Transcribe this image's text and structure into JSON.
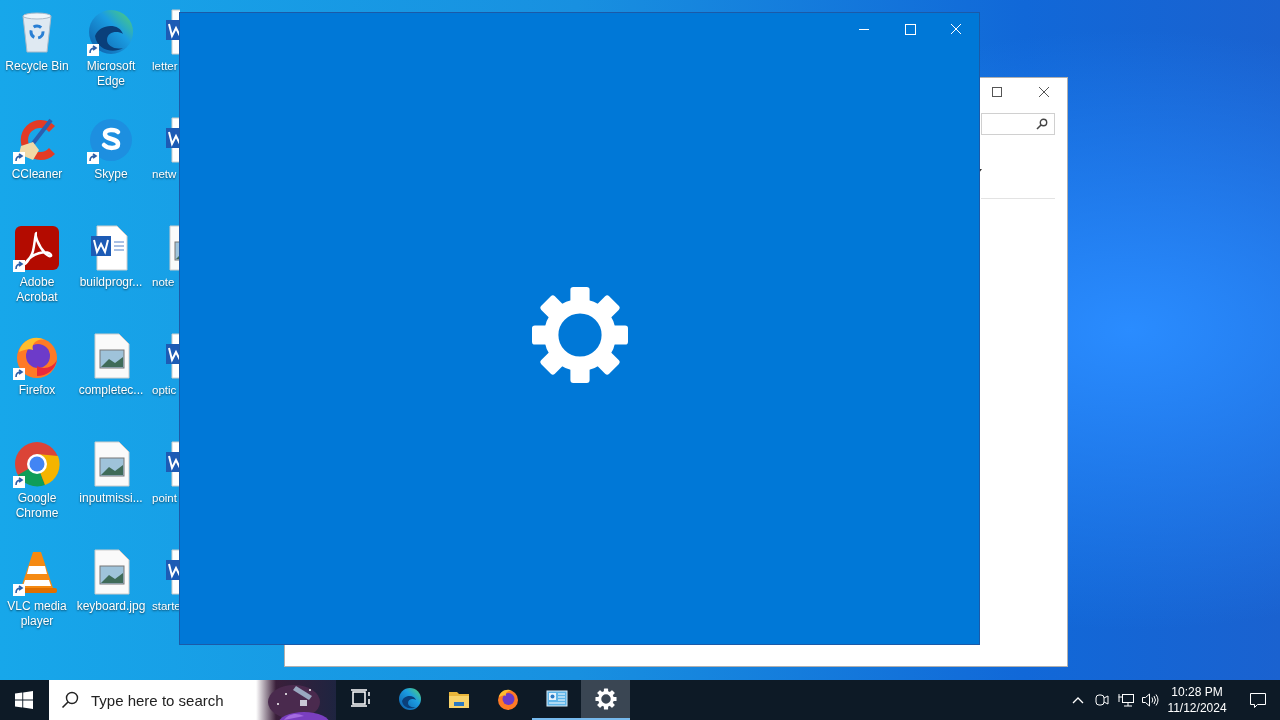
{
  "desktop": {
    "icons": [
      {
        "label": "Recycle Bin",
        "kind": "recycle-bin",
        "shortcut": false
      },
      {
        "label": "CCleaner",
        "kind": "ccleaner",
        "shortcut": true
      },
      {
        "label": "Adobe Acrobat",
        "kind": "acrobat",
        "shortcut": true
      },
      {
        "label": "Firefox",
        "kind": "firefox",
        "shortcut": true
      },
      {
        "label": "Google Chrome",
        "kind": "chrome",
        "shortcut": true
      },
      {
        "label": "VLC media player",
        "kind": "vlc",
        "shortcut": true
      },
      {
        "label": "Microsoft Edge",
        "kind": "edge",
        "shortcut": true
      },
      {
        "label": "Skype",
        "kind": "skype",
        "shortcut": true
      },
      {
        "label": "buildprogr...",
        "kind": "word-doc",
        "shortcut": false
      },
      {
        "label": "completec...",
        "kind": "image-doc",
        "shortcut": false
      },
      {
        "label": "inputmissi...",
        "kind": "image-doc",
        "shortcut": false
      },
      {
        "label": "keyboard.jpg",
        "kind": "image-doc",
        "shortcut": false
      },
      {
        "label": "letter",
        "kind": "word-doc",
        "shortcut": false
      },
      {
        "label": "netw",
        "kind": "word-doc",
        "shortcut": false
      },
      {
        "label": "note",
        "kind": "image-doc",
        "shortcut": false
      },
      {
        "label": "optic",
        "kind": "word-doc",
        "shortcut": false
      },
      {
        "label": "point",
        "kind": "word-doc",
        "shortcut": false
      },
      {
        "label": "starte",
        "kind": "word-doc",
        "shortcut": false
      }
    ]
  },
  "background_window": {
    "kind": "explorer"
  },
  "settings_window": {
    "kind": "settings",
    "loading": true
  },
  "taskbar": {
    "search": {
      "placeholder": "Type here to search"
    },
    "apps": [
      {
        "kind": "task-view",
        "running": false,
        "selected": false
      },
      {
        "kind": "edge",
        "running": false,
        "selected": false
      },
      {
        "kind": "folder",
        "running": false,
        "selected": false
      },
      {
        "kind": "firefox",
        "running": false,
        "selected": false
      },
      {
        "kind": "control-panel",
        "running": true,
        "selected": false
      },
      {
        "kind": "settings",
        "running": true,
        "selected": true
      }
    ],
    "clock": {
      "time": "10:28 PM",
      "date": "11/12/2024"
    }
  }
}
